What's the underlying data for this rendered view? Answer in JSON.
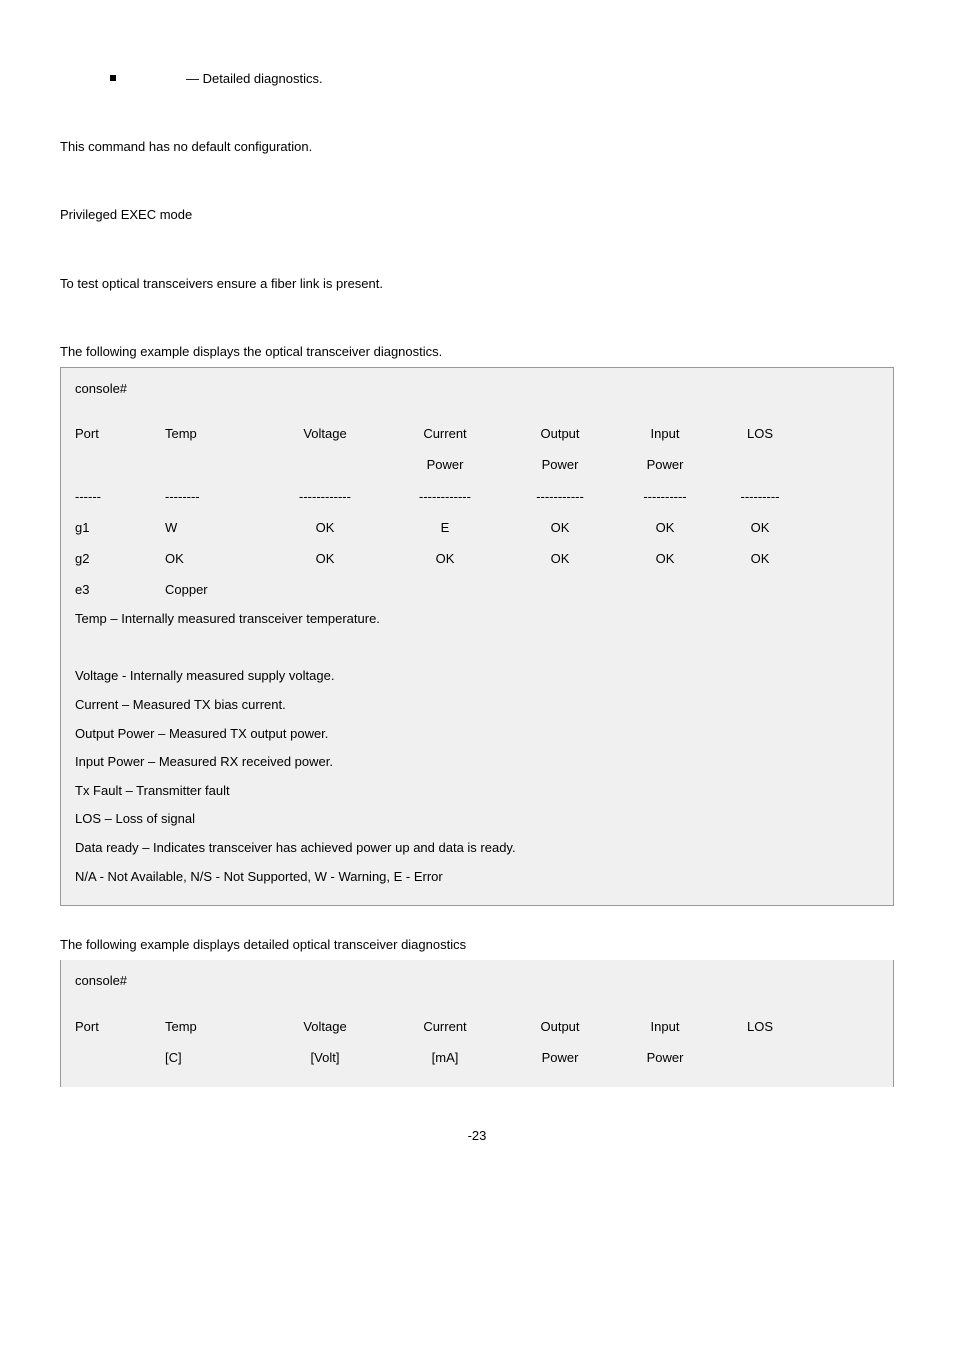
{
  "bullet_text": "— Detailed diagnostics.",
  "para1": "This command has no default configuration.",
  "para2": "Privileged EXEC mode",
  "para3": "To test optical transceivers ensure a fiber link is present.",
  "example1_caption": "The following example displays the optical transceiver diagnostics.",
  "box1": {
    "prompt": "console#",
    "headers": {
      "c1": "Port",
      "c2": "Temp",
      "c3": "Voltage",
      "c4": "Current",
      "c5": "Output",
      "c6": "Input",
      "c7": "LOS",
      "c4b": "Power",
      "c5b": "Power",
      "c6b": "Power"
    },
    "dashes": {
      "c1": "------",
      "c2": "--------",
      "c3": "------------",
      "c4": "------------",
      "c5": "-----------",
      "c6": "----------",
      "c7": "---------"
    },
    "rows": [
      {
        "c1": "g1",
        "c2": "W",
        "c3": "OK",
        "c4": "E",
        "c5": "OK",
        "c6": "OK",
        "c7": "OK"
      },
      {
        "c1": "g2",
        "c2": "OK",
        "c3": "OK",
        "c4": "OK",
        "c5": "OK",
        "c6": "OK",
        "c7": "OK"
      },
      {
        "c1": "e3",
        "c2": "Copper",
        "c3": "",
        "c4": "",
        "c5": "",
        "c6": "",
        "c7": ""
      }
    ],
    "notes": [
      "Temp – Internally measured transceiver temperature.",
      "",
      "Voltage - Internally measured supply voltage.",
      "Current – Measured TX bias current.",
      "Output Power – Measured TX output power.",
      "Input Power – Measured RX received power.",
      "Tx Fault – Transmitter fault",
      "LOS – Loss of signal",
      "Data ready – Indicates transceiver has achieved power up and data is ready.",
      "N/A - Not Available, N/S - Not Supported, W - Warning, E - Error"
    ]
  },
  "example2_caption": "The following example displays detailed optical transceiver diagnostics",
  "box2": {
    "prompt": "console#",
    "headers": {
      "c1": "Port",
      "c2": "Temp",
      "c3": "Voltage",
      "c4": "Current",
      "c5": "Output",
      "c6": "Input",
      "c7": "LOS",
      "c2b": "[C]",
      "c3b": "[Volt]",
      "c4b": "[mA]",
      "c5b": "Power",
      "c6b": "Power"
    }
  },
  "page_num": "-23"
}
